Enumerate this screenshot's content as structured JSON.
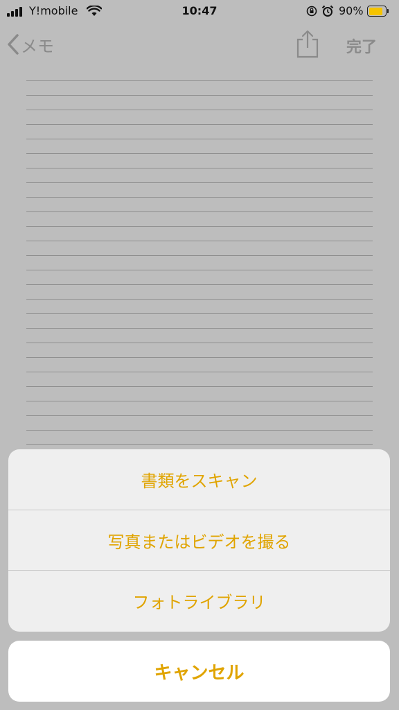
{
  "status_bar": {
    "carrier": "Y!mobile",
    "time": "10:47",
    "battery_percent": "90%",
    "battery_level": 0.9,
    "icons": [
      "signal-icon",
      "wifi-icon",
      "rotation-lock-icon",
      "alarm-icon",
      "battery-icon"
    ]
  },
  "nav": {
    "back_label": "メモ",
    "done_label": "完了",
    "icons": [
      "chevron-left-icon",
      "share-icon"
    ]
  },
  "action_sheet": {
    "items": [
      {
        "label": "書類をスキャン"
      },
      {
        "label": "写真またはビデオを撮る"
      },
      {
        "label": "フォトライブラリ"
      }
    ],
    "cancel_label": "キャンセル"
  },
  "colors": {
    "accent": "#e0a400",
    "dimmed_background": "#bdbdbd",
    "sheet_background": "#efefef",
    "battery": "#f5c400"
  }
}
